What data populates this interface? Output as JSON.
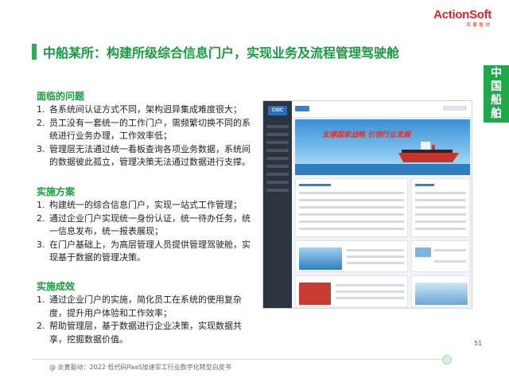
{
  "logo": {
    "main": "ActionSoft",
    "sub": "炎黄盈动"
  },
  "title": "中船某所：构建所级综合信息门户，实现业务及流程管理驾驶舱",
  "side_tab": [
    "中",
    "国",
    "船",
    "舶"
  ],
  "sections": [
    {
      "heading": "面临的问题",
      "items": [
        {
          "num": "1.",
          "text": "各系统间认证方式不同，架构迥异集成难度很大；"
        },
        {
          "num": "2.",
          "text": "员工没有一套统一的工作门户，需频繁切换不同的系统进行业务办理，工作效率低；"
        },
        {
          "num": "3.",
          "text": "管理层无法通过统一看板查询各项业务数据，系统间的数据彼此孤立，管理决策无法通过数据进行支撑。"
        }
      ]
    },
    {
      "heading": "实施方案",
      "items": [
        {
          "num": "1.",
          "text": "构建统一的综合信息门户，实现一站式工作管理；"
        },
        {
          "num": "2.",
          "text": "通过企业门户实现统一身份认证，统一待办任务，统一信息发布，统一报表展现；"
        },
        {
          "num": "3.",
          "text": "在门户基础上，为高层管理人员提供管理驾驶舱，实现基于数据的管理决策。"
        }
      ]
    },
    {
      "heading": "实施成效",
      "items": [
        {
          "num": "1.",
          "text": "通过企业门户的实施，简化员工在系统的使用复杂度，提升用户体验和工作效率；"
        },
        {
          "num": "2.",
          "text": "帮助管理层，基于数据进行企业决策，实现数据共享，挖掘数据价值。"
        }
      ]
    }
  ],
  "screenshot": {
    "logo": "CSIC",
    "banner": "支撑国家战略 引领行业发展"
  },
  "page_number": "51",
  "footer": "@ 炎黄盈动：2022 低代码PaaS加速军工行业数字化转型白皮书",
  "colors": {
    "accent": "#1a9a3f",
    "brand": "#d6262b"
  }
}
